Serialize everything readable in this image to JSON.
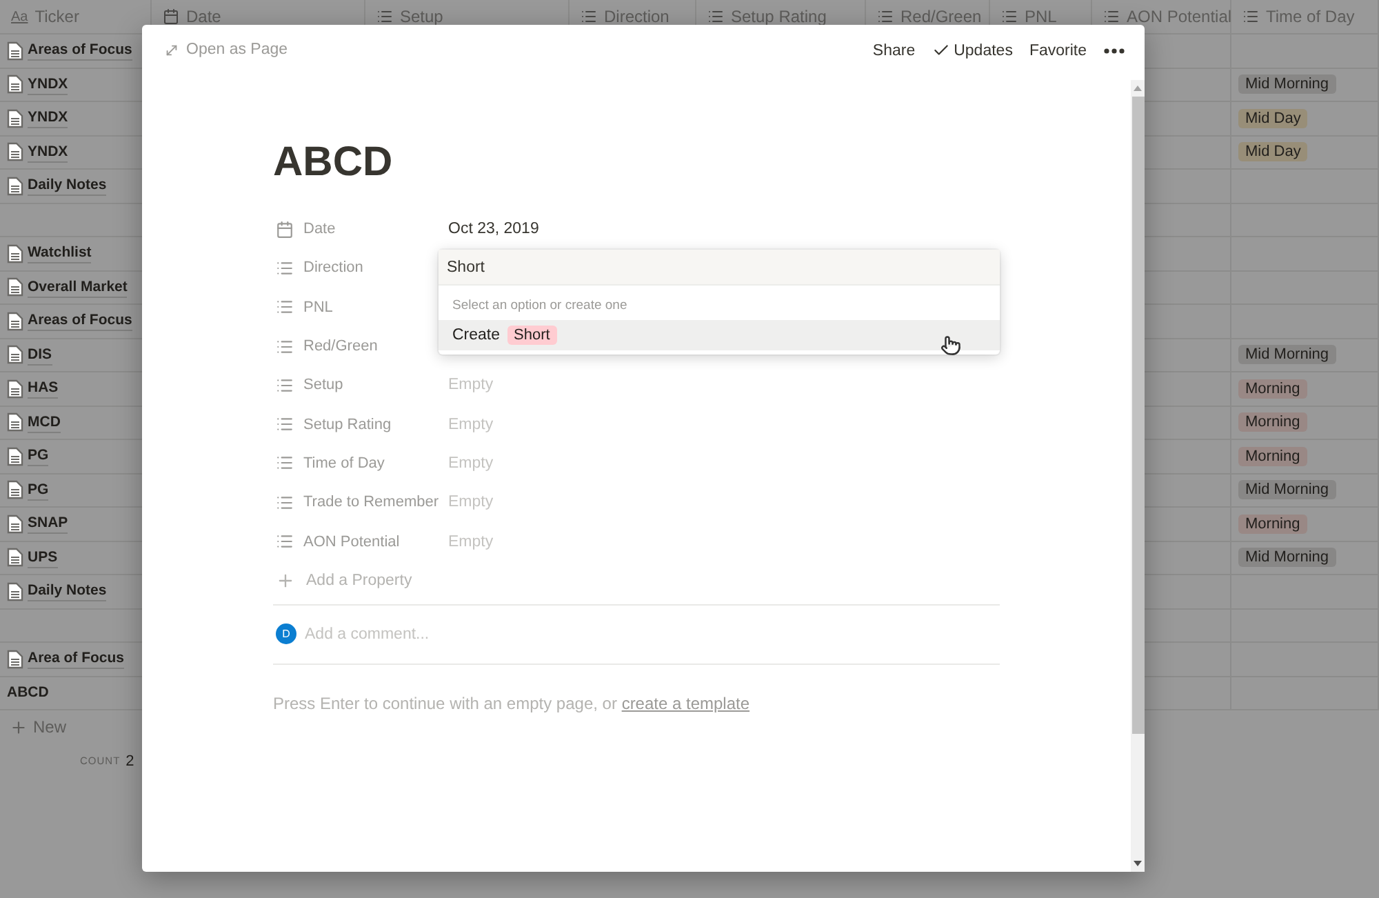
{
  "table": {
    "columns": [
      {
        "label": "Ticker",
        "kind": "title",
        "icon_text": "Aa"
      },
      {
        "label": "Date",
        "kind": "date"
      },
      {
        "label": "Setup",
        "kind": "list"
      },
      {
        "label": "Direction",
        "kind": "list"
      },
      {
        "label": "Setup Rating",
        "kind": "list"
      },
      {
        "label": "Red/Green",
        "kind": "list"
      },
      {
        "label": "PNL",
        "kind": "list"
      },
      {
        "label": "AON Potential",
        "kind": "list"
      },
      {
        "label": "Time of Day",
        "kind": "list"
      }
    ],
    "rows": [
      {
        "kind": "page",
        "ticker": "Areas of Focus"
      },
      {
        "kind": "page",
        "ticker": "YNDX",
        "time_of_day": {
          "label": "Mid Morning",
          "color": "#888786"
        }
      },
      {
        "kind": "page",
        "ticker": "YNDX",
        "time_of_day": {
          "label": "Mid Day",
          "color": "#988e78"
        }
      },
      {
        "kind": "page",
        "ticker": "YNDX",
        "time_of_day": {
          "label": "Mid Day",
          "color": "#988e78"
        }
      },
      {
        "kind": "page",
        "ticker": "Daily Notes"
      },
      {
        "kind": "blank"
      },
      {
        "kind": "page",
        "ticker": "Watchlist"
      },
      {
        "kind": "page",
        "ticker": "Overall Market"
      },
      {
        "kind": "page",
        "ticker": "Areas of Focus"
      },
      {
        "kind": "page",
        "ticker": "DIS",
        "time_of_day": {
          "label": "Mid Morning",
          "color": "#888786"
        }
      },
      {
        "kind": "page",
        "ticker": "HAS",
        "time_of_day": {
          "label": "Morning",
          "color": "#998885"
        }
      },
      {
        "kind": "page",
        "ticker": "MCD",
        "time_of_day": {
          "label": "Morning",
          "color": "#998885"
        }
      },
      {
        "kind": "page",
        "ticker": "PG",
        "time_of_day": {
          "label": "Morning",
          "color": "#998885"
        }
      },
      {
        "kind": "page",
        "ticker": "PG",
        "time_of_day": {
          "label": "Mid Morning",
          "color": "#888786"
        }
      },
      {
        "kind": "page",
        "ticker": "SNAP",
        "time_of_day": {
          "label": "Morning",
          "color": "#998885"
        }
      },
      {
        "kind": "page",
        "ticker": "UPS",
        "time_of_day": {
          "label": "Mid Morning",
          "color": "#888786"
        }
      },
      {
        "kind": "page",
        "ticker": "Daily Notes"
      },
      {
        "kind": "blank"
      },
      {
        "kind": "page",
        "ticker": "Area of Focus"
      },
      {
        "kind": "plain",
        "ticker": "ABCD"
      }
    ],
    "new_label": "New",
    "footer": {
      "label": "COUNT",
      "value": "2"
    }
  },
  "modal": {
    "open_label": "Open as Page",
    "actions": [
      {
        "label": "Share",
        "kind": "text"
      },
      {
        "label": "Updates",
        "kind": "check"
      },
      {
        "label": "Favorite",
        "kind": "text"
      }
    ],
    "title": "ABCD",
    "properties": [
      {
        "name": "Date",
        "kind": "date",
        "value": "Oct 23, 2019",
        "empty": false
      },
      {
        "name": "Direction",
        "kind": "list"
      },
      {
        "name": "PNL",
        "kind": "list"
      },
      {
        "name": "Red/Green",
        "kind": "list"
      },
      {
        "name": "Setup",
        "kind": "list",
        "value": "Empty",
        "empty": true
      },
      {
        "name": "Setup Rating",
        "kind": "list",
        "value": "Empty",
        "empty": true
      },
      {
        "name": "Time of Day",
        "kind": "list",
        "value": "Empty",
        "empty": true
      },
      {
        "name": "Trade to Remember",
        "kind": "list",
        "value": "Empty",
        "empty": true
      },
      {
        "name": "AON Potential",
        "kind": "list",
        "value": "Empty",
        "empty": true
      }
    ],
    "add_property": "Add a Property",
    "comment": {
      "avatar": "D",
      "placeholder": "Add a comment..."
    },
    "hint": {
      "text": "Press Enter to continue with an empty page, or ",
      "link": "create a template"
    },
    "dropdown": {
      "value": "Short",
      "hint": "Select an option or create one",
      "options": [
        {
          "label": "Create",
          "tag": "Short",
          "color": "#ffccd1",
          "selected": true
        }
      ]
    }
  }
}
